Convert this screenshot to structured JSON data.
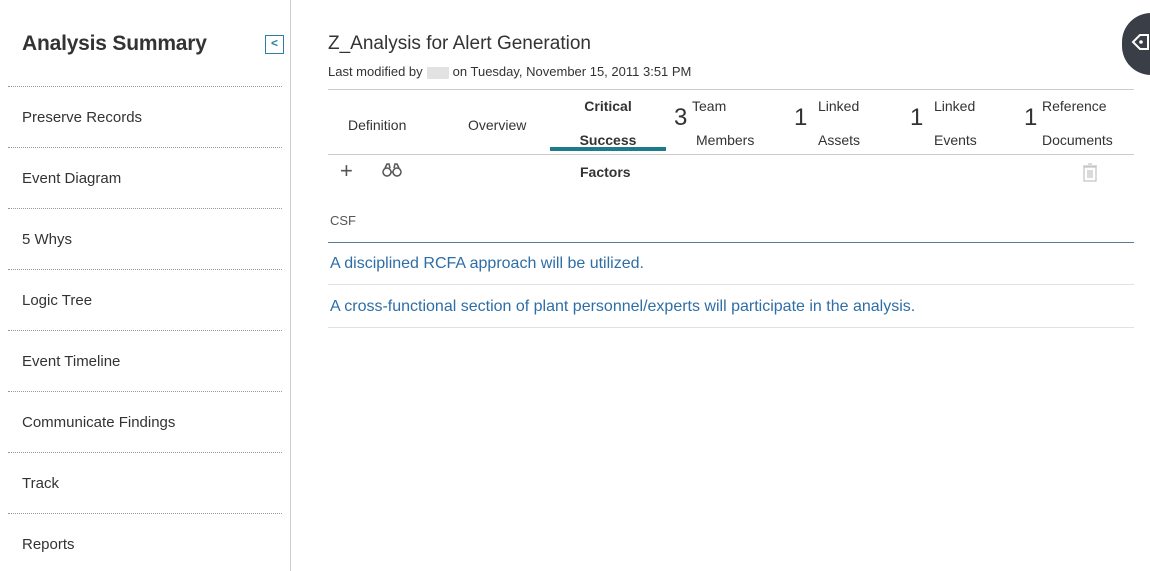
{
  "sidebar": {
    "title": "Analysis Summary",
    "collapse_glyph": "<",
    "items": [
      {
        "label": "Preserve Records"
      },
      {
        "label": "Event Diagram"
      },
      {
        "label": "5 Whys"
      },
      {
        "label": "Logic Tree"
      },
      {
        "label": "Event Timeline"
      },
      {
        "label": "Communicate Findings"
      },
      {
        "label": "Track"
      },
      {
        "label": "Reports"
      }
    ]
  },
  "header": {
    "title": "Z_Analysis for Alert Generation",
    "modified_prefix": "Last modified by",
    "modified_suffix": "on Tuesday, November 15, 2011 3:51 PM"
  },
  "tabs": {
    "definition": "Definition",
    "overview": "Overview",
    "csf": {
      "line1": "Critical",
      "line2": "Success",
      "line3": "Factors"
    },
    "team": {
      "count": "3",
      "line1": "Team",
      "line2": "Members"
    },
    "assets": {
      "count": "1",
      "line1": "Linked",
      "line2": "Assets"
    },
    "events": {
      "count": "1",
      "line1": "Linked",
      "line2": "Events"
    },
    "docs": {
      "count": "1",
      "line1": "Reference",
      "line2": "Documents"
    }
  },
  "toolbar": {
    "add_glyph": "+",
    "icons": [
      "plus-icon",
      "binoculars-icon",
      "trash-icon"
    ]
  },
  "grid": {
    "column_header": "CSF",
    "rows": [
      "A disciplined RCFA approach will be utilized.",
      "A cross-functional section of plant personnel/experts will participate in the analysis."
    ]
  },
  "colors": {
    "accent": "#1d7b8a",
    "link": "#2e6ea6",
    "fab": "#3a3f47"
  }
}
